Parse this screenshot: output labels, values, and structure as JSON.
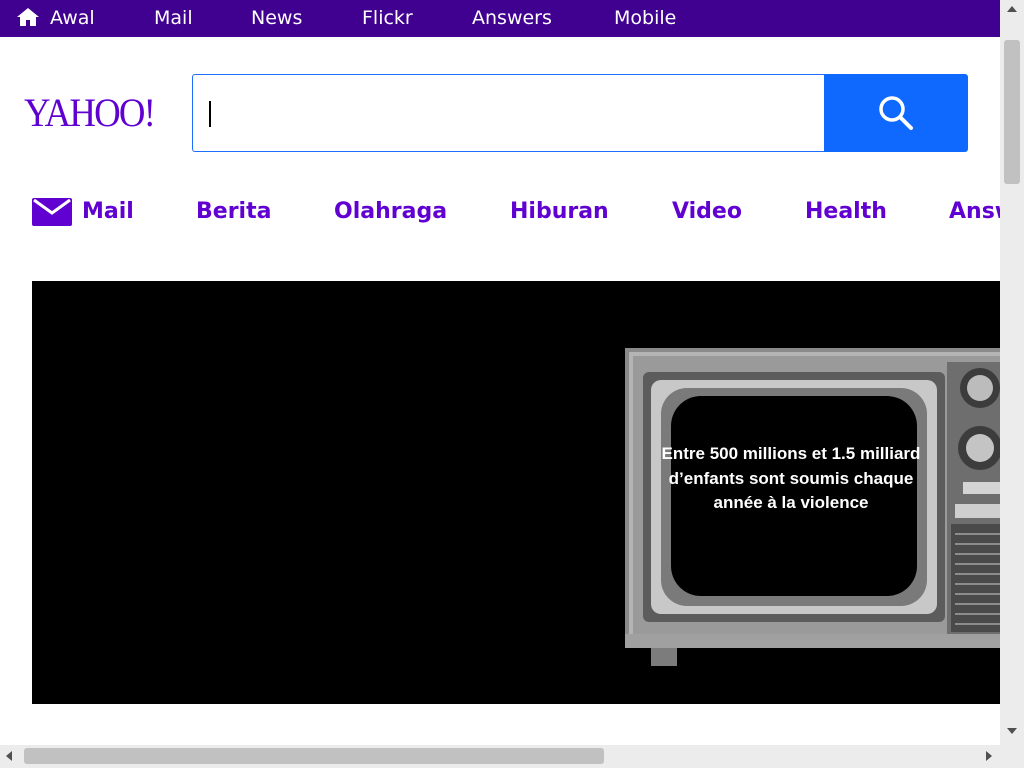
{
  "topbar": {
    "background": "#400090",
    "items": [
      {
        "label": "Awal",
        "icon": "home-icon"
      },
      {
        "label": "Mail"
      },
      {
        "label": "News"
      },
      {
        "label": "Flickr"
      },
      {
        "label": "Answers"
      },
      {
        "label": "Mobile"
      }
    ]
  },
  "logo": {
    "text": "YAHOO!",
    "color": "#5f01d1"
  },
  "search": {
    "value": "",
    "placeholder": "",
    "button_icon": "search-icon",
    "button_color": "#0f69ff"
  },
  "nav": {
    "color": "#6001d2",
    "items": [
      {
        "label": "Mail",
        "icon": "mail-icon"
      },
      {
        "label": "Berita"
      },
      {
        "label": "Olahraga"
      },
      {
        "label": "Hiburan"
      },
      {
        "label": "Video"
      },
      {
        "label": "Health"
      },
      {
        "label": "Answers"
      }
    ]
  },
  "video": {
    "caption": "Entre 500 millions et 1.5 milliard d’enfants sont soumis chaque année à la violence"
  }
}
